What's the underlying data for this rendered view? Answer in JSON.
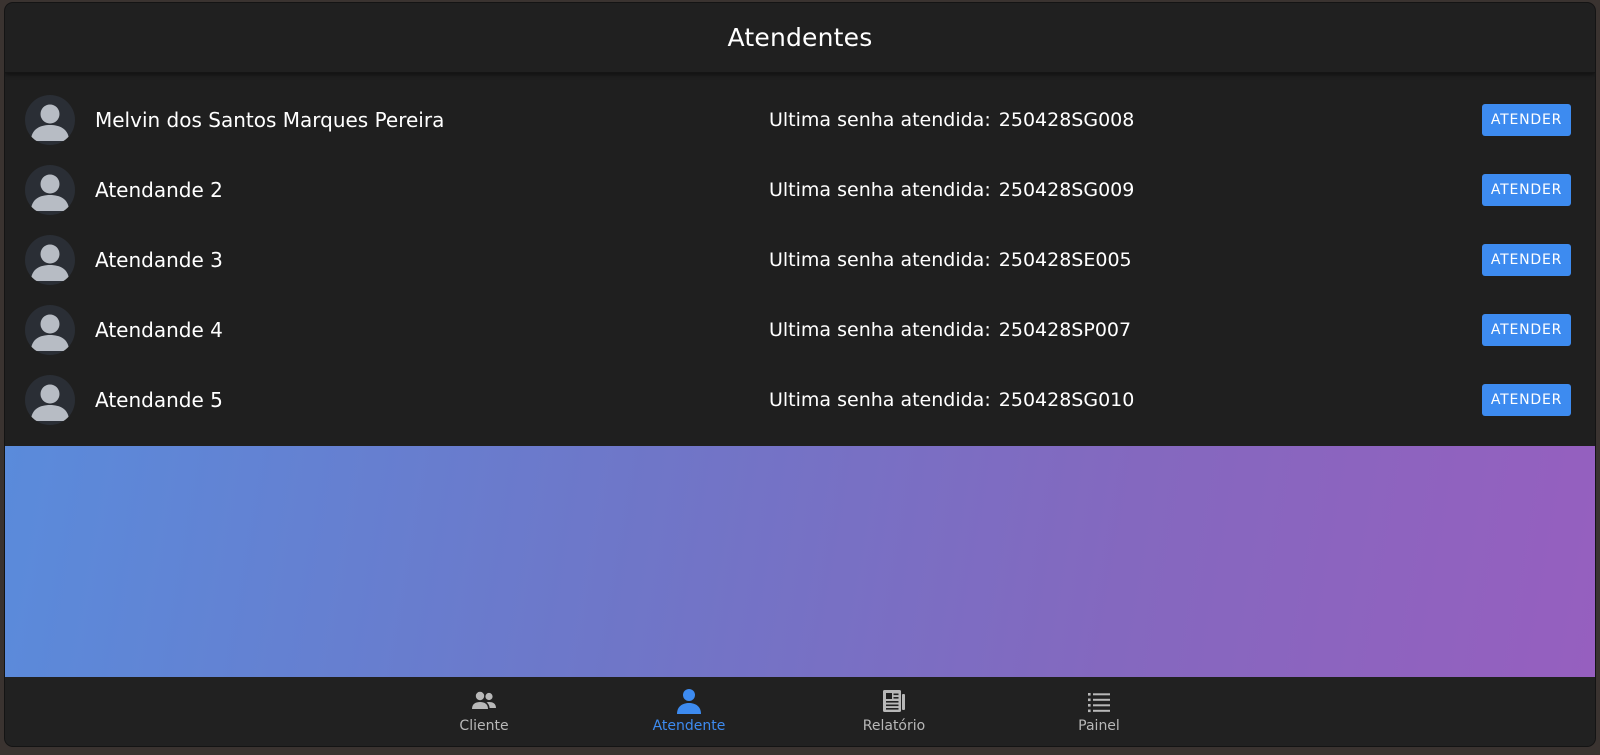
{
  "header": {
    "title": "Atendentes"
  },
  "attendants": [
    {
      "name": "Melvin dos Santos Marques Pereira",
      "senha_label": "Ultima senha atendida:",
      "senha": "250428SG008",
      "button": "ATENDER"
    },
    {
      "name": "Atendande 2",
      "senha_label": "Ultima senha atendida:",
      "senha": "250428SG009",
      "button": "ATENDER"
    },
    {
      "name": "Atendande 3",
      "senha_label": "Ultima senha atendida:",
      "senha": "250428SE005",
      "button": "ATENDER"
    },
    {
      "name": "Atendande 4",
      "senha_label": "Ultima senha atendida:",
      "senha": "250428SP007",
      "button": "ATENDER"
    },
    {
      "name": "Atendande 5",
      "senha_label": "Ultima senha atendida:",
      "senha": "250428SG010",
      "button": "ATENDER"
    }
  ],
  "bottom_nav": [
    {
      "label": "Cliente",
      "icon": "people-icon",
      "active": false
    },
    {
      "label": "Atendente",
      "icon": "person-icon",
      "active": true
    },
    {
      "label": "Relatório",
      "icon": "newspaper-icon",
      "active": false
    },
    {
      "label": "Painel",
      "icon": "list-icon",
      "active": false
    }
  ],
  "colors": {
    "accent": "#3d8bf0",
    "background": "#1f1f1f",
    "gradient_start": "#5a8bdb",
    "gradient_end": "#965fbf"
  }
}
